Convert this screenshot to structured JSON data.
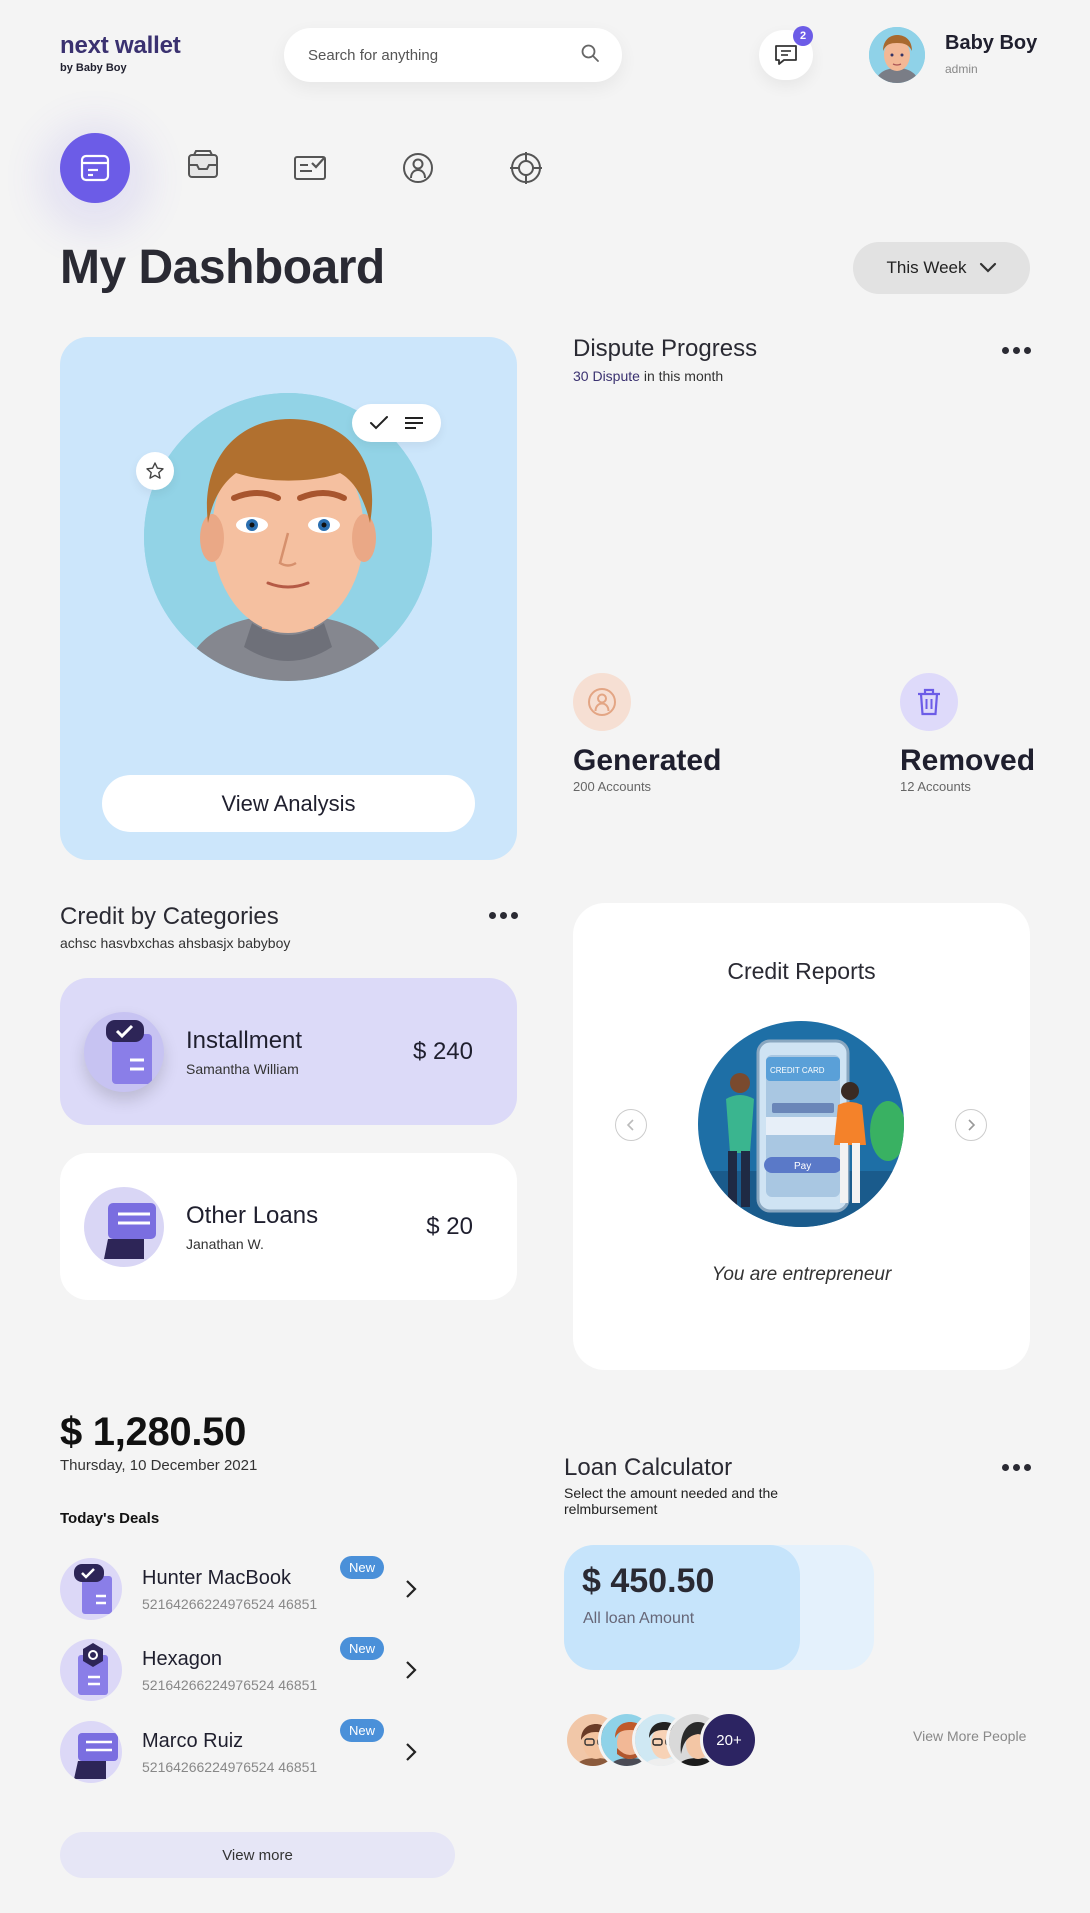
{
  "brand": {
    "name": "next wallet",
    "sub": "by Baby Boy"
  },
  "search": {
    "placeholder": "Search for anything"
  },
  "messages": {
    "count": "2"
  },
  "user": {
    "name": "Baby Boy",
    "role": "admin"
  },
  "nav": [
    "wallet-icon",
    "inbox-icon",
    "task-icon",
    "profile-icon",
    "target-icon"
  ],
  "page": {
    "title": "My Dashboard",
    "period": "This Week"
  },
  "profile_card": {
    "button": "View Analysis"
  },
  "dispute": {
    "title": "Dispute Progress",
    "count": "30 Dispute",
    "suffix": " in this month",
    "generated": {
      "title": "Generated",
      "sub": "200 Accounts"
    },
    "removed": {
      "title": "Removed",
      "sub": "12 Accounts"
    }
  },
  "categories": {
    "title": "Credit by Categories",
    "subtitle": "achsc hasvbxchas ahsbasjx babyboy",
    "items": [
      {
        "name": "Installment",
        "person": "Samantha William",
        "amount": "$ 240"
      },
      {
        "name": "Other Loans",
        "person": "Janathan W.",
        "amount": "$ 20"
      }
    ]
  },
  "reports": {
    "title": "Credit Reports",
    "caption": "You are entrepreneur",
    "card_label": "CREDIT CARD",
    "pay_label": "Pay"
  },
  "balance": {
    "amount": "$ 1,280.50",
    "date": "Thursday, 10 December 2021"
  },
  "deals": {
    "title": "Today's Deals",
    "items": [
      {
        "name": "Hunter MacBook",
        "code": "52164266224976524 46851",
        "tag": "New"
      },
      {
        "name": "Hexagon",
        "code": "52164266224976524 46851",
        "tag": "New"
      },
      {
        "name": "Marco Ruiz",
        "code": "52164266224976524 46851",
        "tag": "New"
      }
    ],
    "view_more": "View more"
  },
  "loan": {
    "title": "Loan Calculator",
    "subtitle": "Select the amount needed and the relmbursement",
    "amount": "$ 450.50",
    "label": "All loan Amount",
    "fill_fraction": 0.76,
    "more_people": "20+",
    "view_people": "View More People"
  },
  "colors": {
    "accent": "#6c5ce7",
    "card_blue": "#cce6fb",
    "card_lavender": "#dcdaf8",
    "tag_blue": "#4a90d9"
  }
}
